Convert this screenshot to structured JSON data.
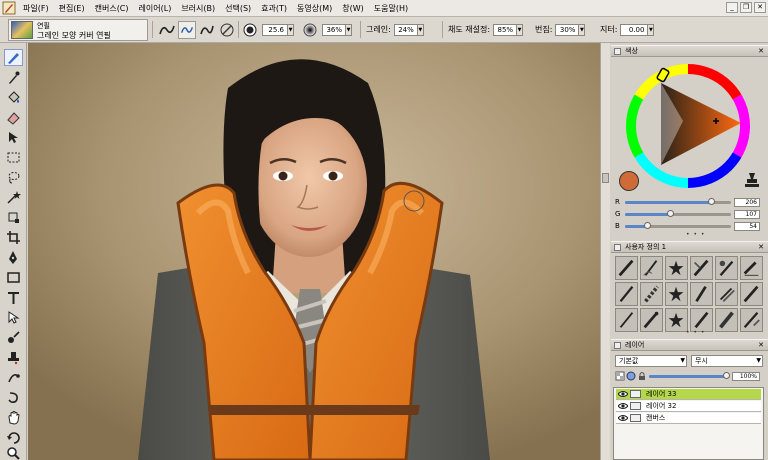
{
  "menu": [
    "파일(F)",
    "편집(E)",
    "캔버스(C)",
    "레이어(L)",
    "브러시(B)",
    "선택(S)",
    "효과(T)",
    "동영상(M)",
    "창(W)",
    "도움말(H)"
  ],
  "tool_preset": {
    "category": "연필",
    "name": "그레인 모양 커버 연필"
  },
  "options": {
    "size_value": "25.6",
    "opacity_value": "36%",
    "grain_label": "그레인:",
    "grain_value": "24%",
    "resat_label": "채도 재설정:",
    "resat_value": "85%",
    "bleed_label": "번짐:",
    "bleed_value": "30%",
    "jitter_label": "지터:",
    "jitter_value": "0.00"
  },
  "color_panel": {
    "title": "색상",
    "r_label": "R",
    "r_value": "206",
    "r_fraction": 0.81,
    "g_label": "G",
    "g_value": "107",
    "g_fraction": 0.42,
    "b_label": "B",
    "b_value": "54",
    "b_fraction": 0.21,
    "main_color": "#ce6b36"
  },
  "brush_panel": {
    "title": "사용자 정의 1"
  },
  "layers_panel": {
    "title": "레이어",
    "blend_mode": "기본값",
    "composite": "무시",
    "opacity": "100%",
    "layers": [
      {
        "name": "레이어 33",
        "selected": true
      },
      {
        "name": "레이어 32",
        "selected": false
      },
      {
        "name": "캔버스",
        "selected": false
      }
    ]
  },
  "colors": {
    "selected_layer": "#b4d84a",
    "vest_orange": "#e8821e"
  }
}
